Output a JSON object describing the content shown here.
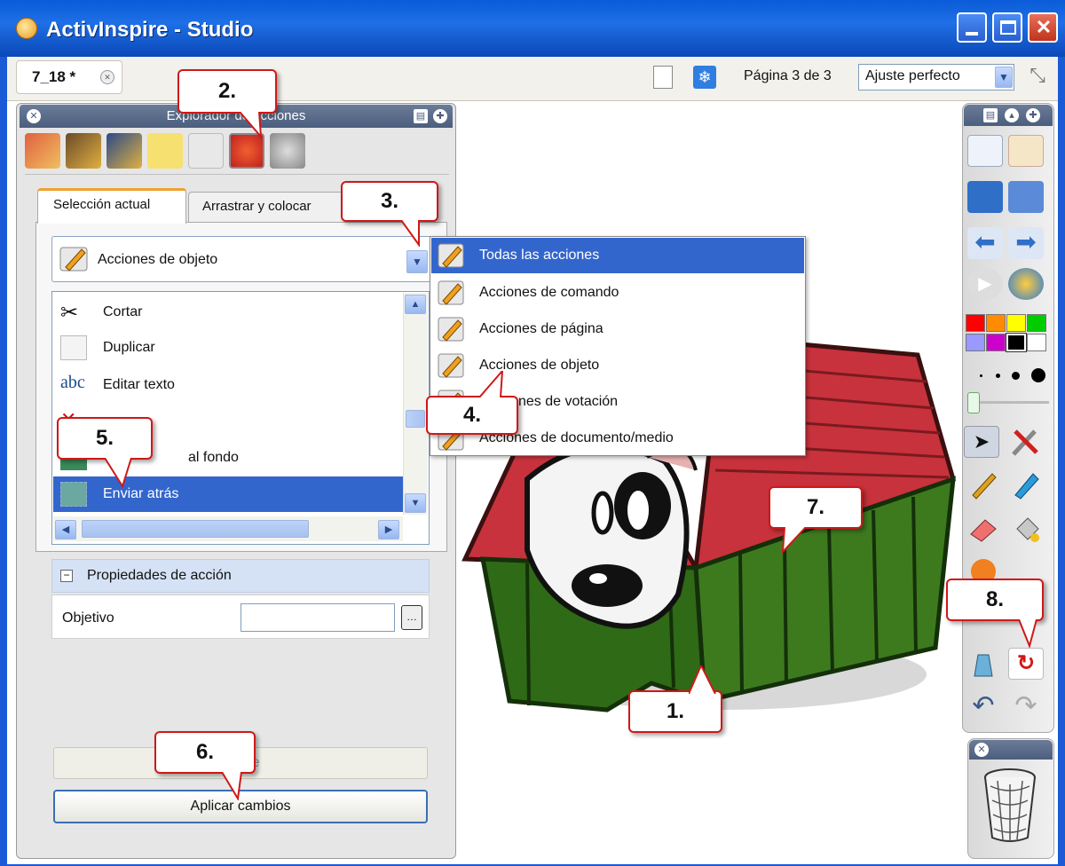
{
  "window": {
    "title": "ActivInspire - Studio"
  },
  "toolbar": {
    "doc_tab": "7_18 *",
    "page_indicator": "Página 3 de 3",
    "zoom_value": "Ajuste perfecto"
  },
  "explorer": {
    "title": "Explorador de acciones",
    "tabs": [
      "Selección actual",
      "Arrastrar y colocar"
    ],
    "action_filter": "Acciones de objeto",
    "actions": [
      {
        "label": "Cortar",
        "icon": "scissors-icon"
      },
      {
        "label": "Duplicar",
        "icon": "duplicate-icon"
      },
      {
        "label": "Editar texto",
        "icon": "edit-text-icon"
      },
      {
        "label": "",
        "icon": "delete-icon"
      },
      {
        "label": "al fondo",
        "icon": "send-to-back-icon"
      },
      {
        "label": "Enviar atrás",
        "icon": "send-backward-icon"
      }
    ],
    "properties_title": "Propiedades de acción",
    "target_label": "Objetivo",
    "target_value": "",
    "assistant_button": "stente",
    "apply_button": "Aplicar cambios"
  },
  "menu": {
    "items": [
      "Todas las acciones",
      "Acciones de comando",
      "Acciones de página",
      "Acciones de objeto",
      "nes de votación",
      "Acciones de documento/medio"
    ]
  },
  "callouts": [
    "1.",
    "2.",
    "3.",
    "4.",
    "5.",
    "6.",
    "7.",
    "8."
  ],
  "palette": {
    "colors": [
      "#ff0000",
      "#ff8c00",
      "#ffff00",
      "#00cc00",
      "#9999ff",
      "#cc00cc",
      "#000000",
      "#ffffff"
    ]
  }
}
